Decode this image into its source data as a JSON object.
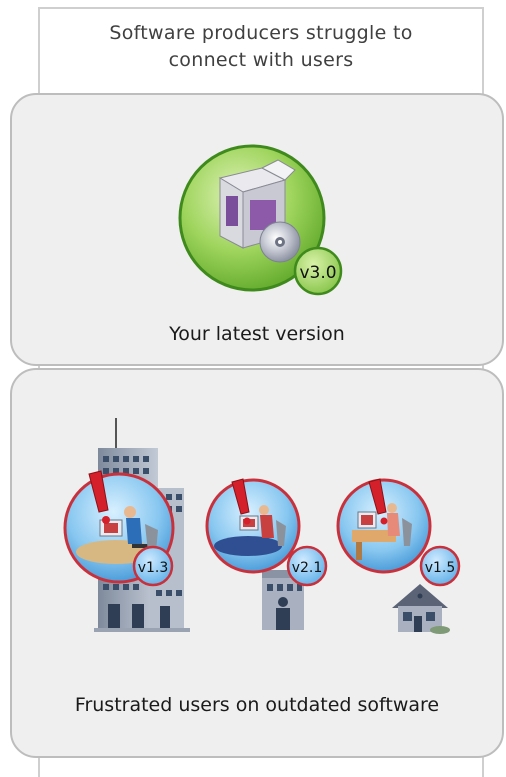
{
  "header": {
    "line1": "Software producers struggle to",
    "line2": "connect with users"
  },
  "product": {
    "version_badge": "v3.0",
    "caption": "Your latest version"
  },
  "users": {
    "items": [
      {
        "setting": "office-tower",
        "version_badge": "v1.3"
      },
      {
        "setting": "small-office",
        "version_badge": "v2.1"
      },
      {
        "setting": "home",
        "version_badge": "v1.5"
      }
    ],
    "caption": "Frustrated users on outdated software"
  },
  "colors": {
    "panel_fill": "#efefef",
    "panel_border": "#bdbdbd",
    "product_circle": "#7cc43a",
    "user_circle_border": "#c8313c",
    "badge_green": "#9bd35a",
    "badge_blue": "#4fa3de",
    "alert_red": "#d4202a"
  }
}
